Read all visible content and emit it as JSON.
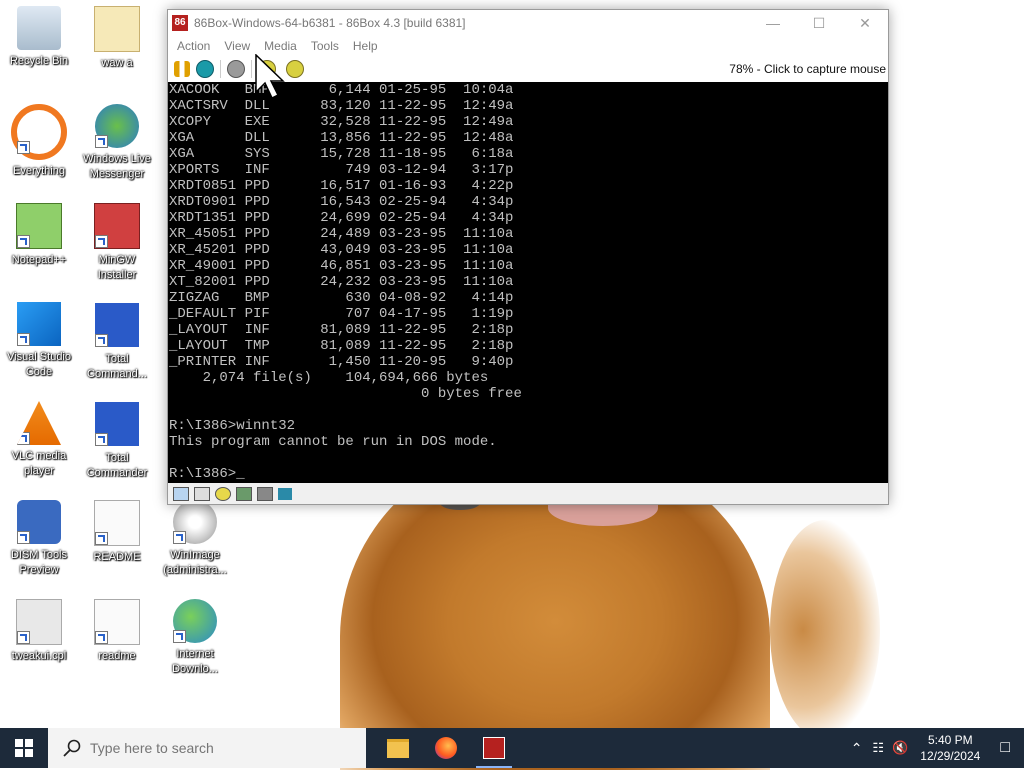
{
  "desktop": {
    "icons": [
      {
        "label": "Recycle Bin"
      },
      {
        "label": "waw a"
      },
      {
        "label": "Everything"
      },
      {
        "label": "Windows Live Messenger"
      },
      {
        "label": "Notepad++"
      },
      {
        "label": "MinGW Installer"
      },
      {
        "label": "Visual Studio Code"
      },
      {
        "label": "Total Command..."
      },
      {
        "label": "VLC media player"
      },
      {
        "label": "Total Commander"
      },
      {
        "label": "DISM Tools Preview"
      },
      {
        "label": "README"
      },
      {
        "label": "WinImage (administra..."
      },
      {
        "label": "tweakui.cpl"
      },
      {
        "label": "readme"
      },
      {
        "label": "Internet Downlo..."
      }
    ]
  },
  "window": {
    "title": "86Box-Windows-64-b6381 - 86Box 4.3 [build 6381]",
    "app_icon_text": "86",
    "menu": [
      "Action",
      "View",
      "Media",
      "Tools",
      "Help"
    ],
    "capture_status": "78% - Click to capture mouse",
    "console_lines": [
      "XACOOK   BMP       6,144 01-25-95  10:04a",
      "XACTSRV  DLL      83,120 11-22-95  12:49a",
      "XCOPY    EXE      32,528 11-22-95  12:49a",
      "XGA      DLL      13,856 11-22-95  12:48a",
      "XGA      SYS      15,728 11-18-95   6:18a",
      "XPORTS   INF         749 03-12-94   3:17p",
      "XRDT0851 PPD      16,517 01-16-93   4:22p",
      "XRDT0901 PPD      16,543 02-25-94   4:34p",
      "XRDT1351 PPD      24,699 02-25-94   4:34p",
      "XR_45051 PPD      24,489 03-23-95  11:10a",
      "XR_45201 PPD      43,049 03-23-95  11:10a",
      "XR_49001 PPD      46,851 03-23-95  11:10a",
      "XT_82001 PPD      24,232 03-23-95  11:10a",
      "ZIGZAG   BMP         630 04-08-92   4:14p",
      "_DEFAULT PIF         707 04-17-95   1:19p",
      "_LAYOUT  INF      81,089 11-22-95   2:18p",
      "_LAYOUT  TMP      81,089 11-22-95   2:18p",
      "_PRINTER INF       1,450 11-20-95   9:40p",
      "    2,074 file(s)    104,694,666 bytes",
      "                              0 bytes free",
      "",
      "R:\\I386>winnt32",
      "This program cannot be run in DOS mode.",
      "",
      "R:\\I386>_"
    ]
  },
  "taskbar": {
    "search_placeholder": "Type here to search",
    "time": "5:40 PM",
    "date": "12/29/2024"
  },
  "colors": {
    "taskbar_bg": "#1d2a3a",
    "console_bg": "#000000",
    "console_fg": "#c0c0c0"
  }
}
